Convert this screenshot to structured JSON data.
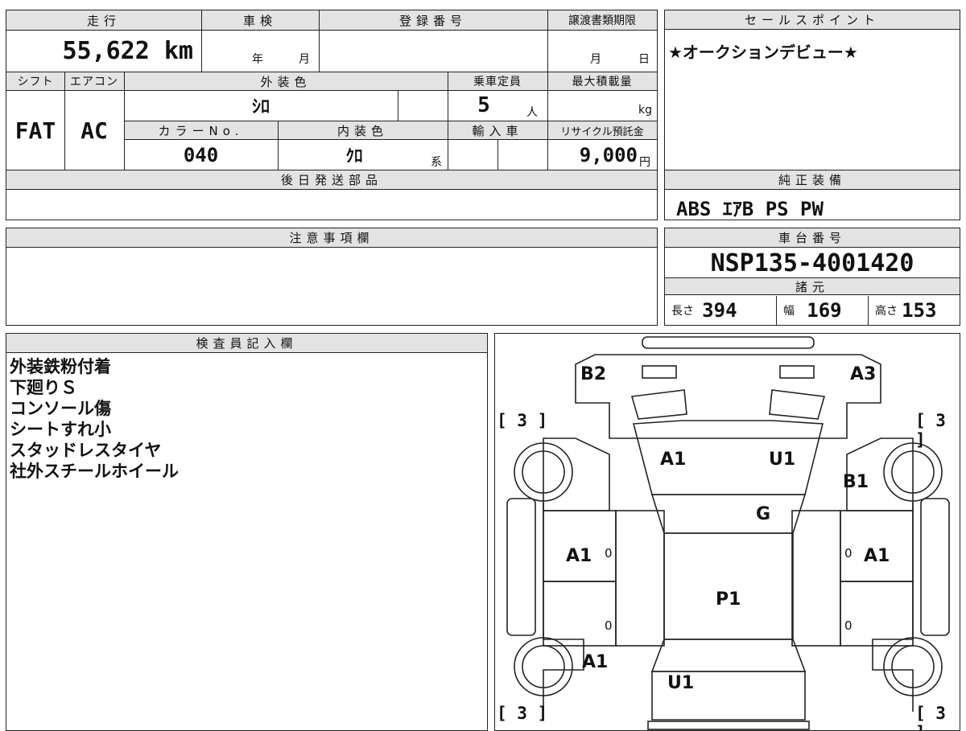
{
  "top_info": {
    "h_run": "走行",
    "h_inspection": "車検",
    "h_reg": "登録番号",
    "h_transfer": "譲渡書類期限",
    "mileage": "55,622",
    "mileage_unit": "km",
    "year_label": "年",
    "month_label": "月",
    "month2_label": "月",
    "day_label": "日",
    "h_shift": "シフト",
    "h_ac": "エアコン",
    "h_ext_color": "外装色",
    "h_capacity": "乗車定員",
    "h_load": "最大積載量",
    "shift": "FAT",
    "ac": "AC",
    "ext_color": "ｼﾛ",
    "capacity": "5",
    "capacity_unit": "人",
    "load_unit": "kg",
    "h_color_no": "カラーNo.",
    "h_int_color": "内装色",
    "h_import": "輸入車",
    "h_recycle": "リサイクル預託金",
    "color_no": "040",
    "int_color": "ｸﾛ",
    "int_suffix": "系",
    "recycle": "9,000",
    "recycle_unit": "円",
    "h_later_parts": "後日発送部品"
  },
  "sales_point": {
    "header": "セールスポイント",
    "text": "★オークションデビュー★"
  },
  "standard_equipment": {
    "header": "純正装備",
    "text": "ABS ｴｱB PS PW"
  },
  "notes": {
    "header": "注意事項欄"
  },
  "chassis": {
    "header": "車台番号",
    "number": "NSP135-4001420"
  },
  "specs": {
    "header": "諸元",
    "length_label": "長さ",
    "length": "394",
    "width_label": "幅",
    "width": "169",
    "height_label": "高さ",
    "height": "153"
  },
  "inspector": {
    "header": "検査員記入欄",
    "lines": [
      "外装鉄粉付着",
      "下廻りＳ",
      "コンソール傷",
      "シートすれ小",
      "スタッドレスタイヤ",
      "社外スチールホイール"
    ]
  },
  "diagram": {
    "labels": {
      "b2": "B2",
      "a3": "A3",
      "b1": "B1",
      "hood_a1": "A1",
      "hood_u1": "U1",
      "g": "G",
      "left_a1": "A1",
      "right_a1": "A1",
      "roof_p1": "P1",
      "rear_left_a1": "A1",
      "trunk_u1": "U1"
    },
    "tire_bracket": "[ 3 ]",
    "tread_zero": "0"
  }
}
